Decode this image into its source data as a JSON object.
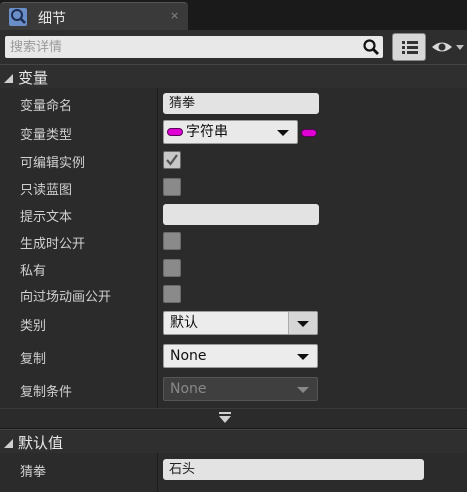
{
  "tab": {
    "title": "细节",
    "close": "×"
  },
  "search": {
    "placeholder": "搜索详情"
  },
  "sections": {
    "variable": "变量",
    "default": "默认值"
  },
  "props": {
    "var_name_label": "变量命名",
    "var_name_value": "猜拳",
    "var_type_label": "变量类型",
    "var_type_value": "字符串",
    "editable_label": "可编辑实例",
    "readonly_label": "只读蓝图",
    "tooltip_label": "提示文本",
    "tooltip_value": "",
    "expose_spawn_label": "生成时公开",
    "private_label": "私有",
    "expose_cine_label": "向过场动画公开",
    "category_label": "类别",
    "category_value": "默认",
    "replication_label": "复制",
    "replication_value": "None",
    "rep_condition_label": "复制条件",
    "rep_condition_value": "None"
  },
  "defaults": {
    "label": "猜拳",
    "value": "石头"
  },
  "checkboxes": {
    "editable": true,
    "readonly": false,
    "expose_spawn": false,
    "private": false,
    "expose_cine": false
  },
  "colors": {
    "string_pin": "#e000d6",
    "panel_bg": "#2b2b2b",
    "header_bg": "#2f2f2f"
  }
}
